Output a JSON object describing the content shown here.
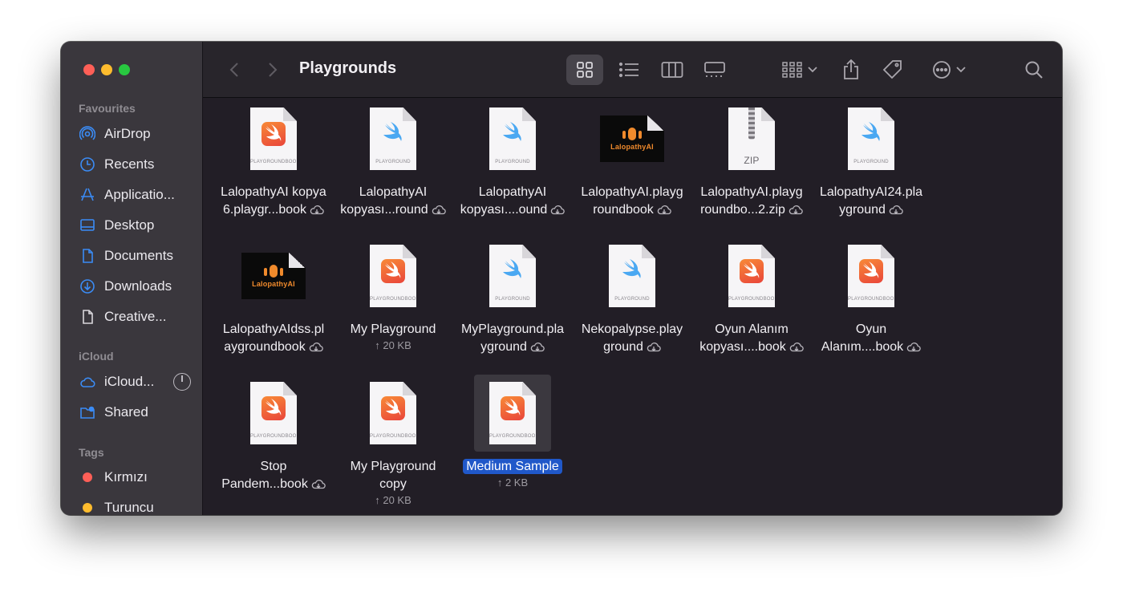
{
  "window": {
    "title": "Playgrounds"
  },
  "sidebar": {
    "favourites_label": "Favourites",
    "icloud_label": "iCloud",
    "tags_label": "Tags",
    "favourites": [
      {
        "label": "AirDrop",
        "icon": "airdrop-icon"
      },
      {
        "label": "Recents",
        "icon": "clock-icon"
      },
      {
        "label": "Applicatio...",
        "icon": "applications-icon"
      },
      {
        "label": "Desktop",
        "icon": "desktop-icon"
      },
      {
        "label": "Documents",
        "icon": "document-icon"
      },
      {
        "label": "Downloads",
        "icon": "download-icon"
      },
      {
        "label": "Creative...",
        "icon": "file-icon"
      }
    ],
    "icloud": [
      {
        "label": "iCloud...",
        "icon": "cloud-icon"
      },
      {
        "label": "Shared",
        "icon": "shared-folder-icon"
      }
    ],
    "tags": [
      {
        "label": "Kırmızı",
        "color": "#fe5f57"
      },
      {
        "label": "Turuncu",
        "color": "#febc2e"
      }
    ]
  },
  "files": [
    {
      "line1": "LalopathyAI kopya",
      "line2": "6.playgr...book",
      "kind": "playgroundbook",
      "cloud": true
    },
    {
      "line1": "LalopathyAI",
      "line2": "kopyası...round",
      "kind": "playground",
      "cloud": true
    },
    {
      "line1": "LalopathyAI",
      "line2": "kopyası....ound",
      "kind": "playground",
      "cloud": true
    },
    {
      "line1": "LalopathyAI.playg",
      "line2": "roundbook",
      "kind": "logo",
      "cloud": true
    },
    {
      "line1": "LalopathyAI.playg",
      "line2": "roundbo...2.zip",
      "kind": "zip",
      "cloud": true
    },
    {
      "line1": "LalopathyAI24.pla",
      "line2": "yground",
      "kind": "playground",
      "cloud": true
    },
    {
      "line1": "LalopathyAIdss.pl",
      "line2": "aygroundbook",
      "kind": "logo",
      "cloud": true
    },
    {
      "line1": "My Playground",
      "line2": "",
      "meta": "↑ 20 KB",
      "kind": "playgroundbook",
      "cloud": false
    },
    {
      "line1": "MyPlayground.pla",
      "line2": "yground",
      "kind": "playground",
      "cloud": true
    },
    {
      "line1": "Nekopalypse.play",
      "line2": "ground",
      "kind": "playground",
      "cloud": true
    },
    {
      "line1": "Oyun Alanım",
      "line2": "kopyası....book",
      "kind": "playgroundbook",
      "cloud": true
    },
    {
      "line1": "Oyun",
      "line2": "Alanım....book",
      "kind": "playgroundbook",
      "cloud": true
    },
    {
      "line1": "Stop",
      "line2": "Pandem...book",
      "kind": "playgroundbook",
      "cloud": true
    },
    {
      "line1": "My Playground",
      "line2": "copy",
      "meta": "↑ 20 KB",
      "kind": "playgroundbook",
      "cloud": false
    },
    {
      "line1": "Medium Sample",
      "line2": "",
      "meta": "↑ 2 KB",
      "kind": "playgroundbook",
      "cloud": false,
      "selected": true
    }
  ],
  "thumb_text": {
    "playgroundbook": "PLAYGROUNDBOOK",
    "playground": "PLAYGROUND",
    "zip": "ZIP",
    "logo": "LalopathyAI"
  },
  "colors": {
    "accent": "#2058c9",
    "swift_orange": "#f0683a",
    "swift_blue": "#4aa8f2"
  }
}
